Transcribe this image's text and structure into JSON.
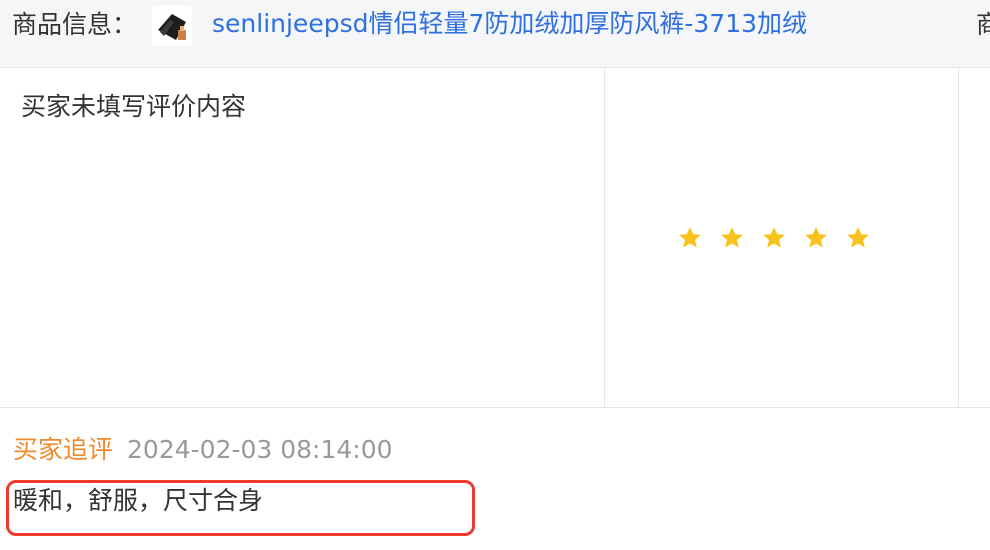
{
  "header": {
    "label": "商品信息：",
    "product_title": "senlinjeepsd情侣轻量7防加绒加厚防风裤-3713加绒",
    "right_partial": "商"
  },
  "review": {
    "content": "买家未填写评价内容",
    "rating": 5,
    "rating_max": 5,
    "star_color": "#f7c21b"
  },
  "followup": {
    "tag": "买家追评",
    "time": "2024-02-03 08:14:00",
    "text": "暖和，舒服，尺寸合身",
    "highlight_color": "#ee3a2c"
  },
  "colors": {
    "link": "#2f6fe0",
    "accent": "#f08a2c",
    "muted": "#999999"
  }
}
